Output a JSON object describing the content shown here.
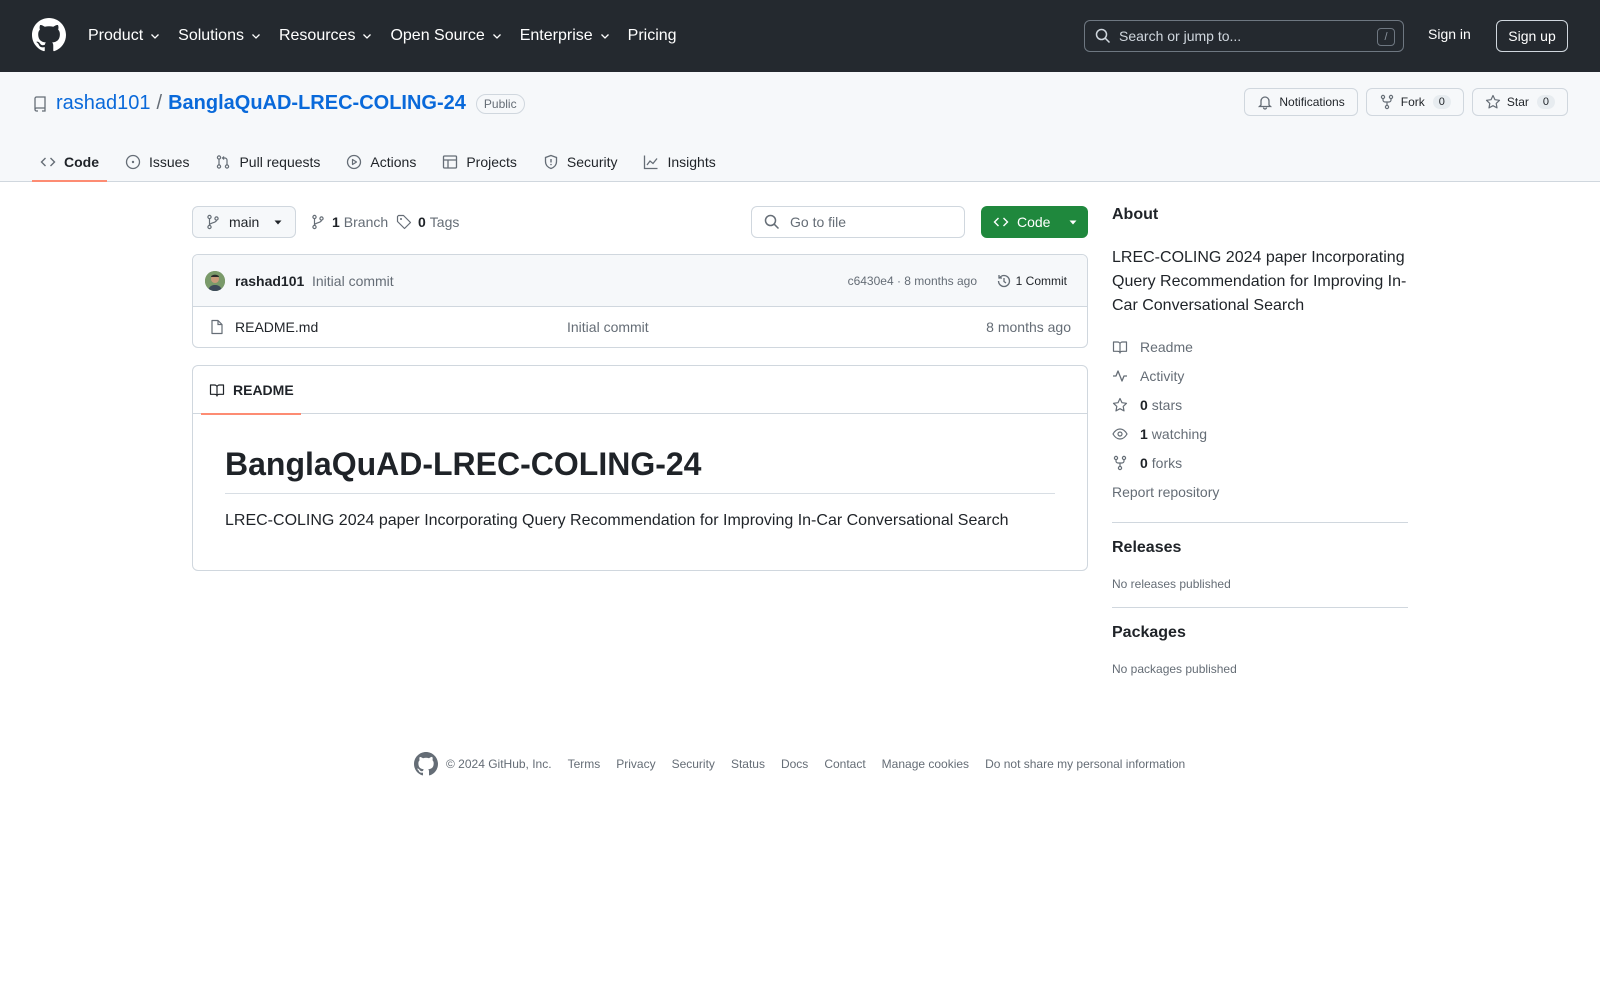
{
  "header": {
    "nav": [
      {
        "label": "Product",
        "dropdown": true
      },
      {
        "label": "Solutions",
        "dropdown": true
      },
      {
        "label": "Resources",
        "dropdown": true
      },
      {
        "label": "Open Source",
        "dropdown": true
      },
      {
        "label": "Enterprise",
        "dropdown": true
      },
      {
        "label": "Pricing",
        "dropdown": false
      }
    ],
    "search_placeholder": "Search or jump to...",
    "search_shortcut": "/",
    "sign_in": "Sign in",
    "sign_up": "Sign up"
  },
  "repo": {
    "owner": "rashad101",
    "separator": "/",
    "name": "BanglaQuAD-LREC-COLING-24",
    "visibility": "Public",
    "notifications_label": "Notifications",
    "fork_label": "Fork",
    "fork_count": "0",
    "star_label": "Star",
    "star_count": "0"
  },
  "tabs": [
    {
      "label": "Code",
      "icon": "code-icon"
    },
    {
      "label": "Issues",
      "icon": "issue-icon"
    },
    {
      "label": "Pull requests",
      "icon": "pull-request-icon"
    },
    {
      "label": "Actions",
      "icon": "play-icon"
    },
    {
      "label": "Projects",
      "icon": "table-icon"
    },
    {
      "label": "Security",
      "icon": "shield-icon"
    },
    {
      "label": "Insights",
      "icon": "graph-icon"
    }
  ],
  "toolbar": {
    "branch": "main",
    "branch_count": "1",
    "branch_label": "Branch",
    "tag_count": "0",
    "tag_label": "Tags",
    "goto_placeholder": "Go to file",
    "code_button": "Code"
  },
  "commit": {
    "author": "rashad101",
    "message": "Initial commit",
    "meta": "c6430e4 · 8 months ago",
    "count_label": "1 Commit"
  },
  "files": [
    {
      "name": "README.md",
      "message": "Initial commit",
      "age": "8 months ago"
    }
  ],
  "readme": {
    "tab_label": "README",
    "heading": "BanglaQuAD-LREC-COLING-24",
    "paragraph": "LREC-COLING 2024 paper Incorporating Query Recommendation for Improving In-Car Conversational Search"
  },
  "about": {
    "title": "About",
    "description": "LREC-COLING 2024 paper Incorporating Query Recommendation for Improving In-Car Conversational Search",
    "readme": "Readme",
    "activity": "Activity",
    "stars_count": "0",
    "stars_label": "stars",
    "watching_count": "1",
    "watching_label": "watching",
    "forks_count": "0",
    "forks_label": "forks",
    "report": "Report repository"
  },
  "releases": {
    "title": "Releases",
    "empty": "No releases published"
  },
  "packages": {
    "title": "Packages",
    "empty": "No packages published"
  },
  "footer": {
    "copyright": "© 2024 GitHub, Inc.",
    "links": [
      "Terms",
      "Privacy",
      "Security",
      "Status",
      "Docs",
      "Contact",
      "Manage cookies",
      "Do not share my personal information"
    ]
  },
  "colors": {
    "header_bg": "#24292f",
    "link": "#0969da",
    "primary_button": "#1f883d",
    "tab_underline": "#fd8c73"
  }
}
